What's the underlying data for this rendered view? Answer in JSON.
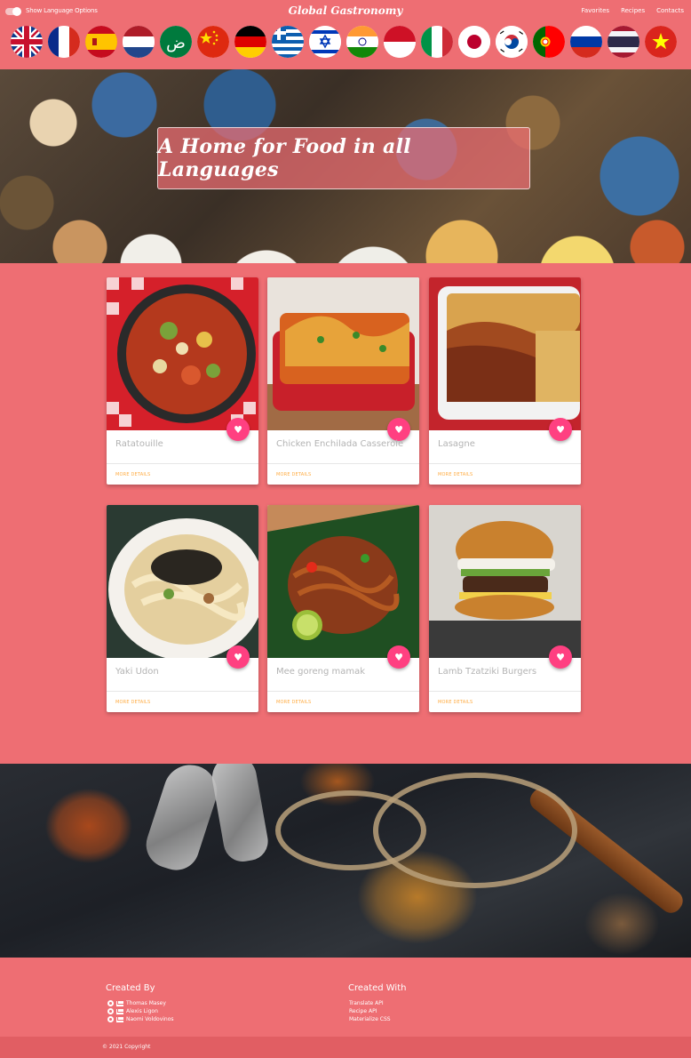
{
  "nav": {
    "toggle_label": "Show Language Options",
    "brand": "Global Gastronomy",
    "links": [
      "Favorites",
      "Recipes",
      "Contacts"
    ]
  },
  "flags": [
    {
      "name": "flag-uk-icon"
    },
    {
      "name": "flag-france-icon"
    },
    {
      "name": "flag-spain-icon"
    },
    {
      "name": "flag-netherlands-icon"
    },
    {
      "name": "flag-arabic-icon"
    },
    {
      "name": "flag-china-icon"
    },
    {
      "name": "flag-germany-icon"
    },
    {
      "name": "flag-greece-icon"
    },
    {
      "name": "flag-israel-icon"
    },
    {
      "name": "flag-india-icon"
    },
    {
      "name": "flag-indonesia-icon"
    },
    {
      "name": "flag-italy-icon"
    },
    {
      "name": "flag-japan-icon"
    },
    {
      "name": "flag-korea-icon"
    },
    {
      "name": "flag-portugal-icon"
    },
    {
      "name": "flag-russia-icon"
    },
    {
      "name": "flag-thailand-icon"
    },
    {
      "name": "flag-vietnam-icon"
    }
  ],
  "hero": {
    "title": "A Home for Food in all Languages"
  },
  "recipes": [
    {
      "title": "Ratatouille",
      "link": "MORE DETAILS"
    },
    {
      "title": "Chicken Enchilada Casserole",
      "link": "MORE DETAILS"
    },
    {
      "title": "Lasagne",
      "link": "MORE DETAILS"
    },
    {
      "title": "Yaki Udon",
      "link": "MORE DETAILS"
    },
    {
      "title": "Mee goreng mamak",
      "link": "MORE DETAILS"
    },
    {
      "title": "Lamb Tzatziki Burgers",
      "link": "MORE DETAILS"
    }
  ],
  "footer": {
    "created_by_heading": "Created By",
    "authors": [
      "Thomas Masey",
      "Alexis Ligon",
      "Naomi Voldovinos"
    ],
    "created_with_heading": "Created With",
    "tools": [
      "Translate API",
      "Recipe API",
      "Materialize CSS"
    ],
    "copyright": "© 2021 Copyright"
  },
  "colors": {
    "primary": "#ee6e73",
    "accent": "#ff4081",
    "link": "#ffab40"
  }
}
